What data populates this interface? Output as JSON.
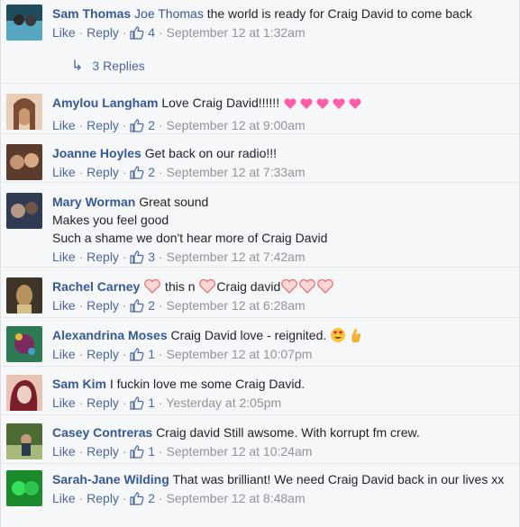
{
  "comments": [
    {
      "name": "Sam Thomas",
      "mention": "Joe Thomas",
      "text": " the world is ready for Craig David to come back",
      "like": "Like",
      "reply": "Reply",
      "likes": "4",
      "time": "September 12 at 1:32am",
      "replies_label": "3 Replies",
      "avatar_colors": [
        "#1f4d5e",
        "#58a7c2"
      ]
    },
    {
      "name": "Amylou Langham",
      "text": "Love Craig David!!!!!! ",
      "like": "Like",
      "reply": "Reply",
      "likes": "2",
      "time": "September 12 at 9:00am",
      "avatar_colors": [
        "#c99770",
        "#7a4d33"
      ]
    },
    {
      "name": "Joanne Hoyles",
      "text": "Get back on our radio!!!",
      "like": "Like",
      "reply": "Reply",
      "likes": "2",
      "time": "September 12 at 7:33am",
      "avatar_colors": [
        "#5b3b2c",
        "#c59473"
      ]
    },
    {
      "name": "Mary Worman",
      "text_lines": [
        "Great sound",
        "Makes you feel good",
        "Such a shame we don't hear more of Craig David"
      ],
      "like": "Like",
      "reply": "Reply",
      "likes": "3",
      "time": "September 12 at 7:42am",
      "avatar_colors": [
        "#303a52",
        "#b49889"
      ]
    },
    {
      "name": "Rachel Carney",
      "text_parts": [
        " this n ",
        "Craig david"
      ],
      "like": "Like",
      "reply": "Reply",
      "likes": "2",
      "time": "September 12 at 6:28am",
      "avatar_colors": [
        "#b89360",
        "#3e3528"
      ]
    },
    {
      "name": "Alexandrina Moses",
      "text": "Craig David love - reignited. ",
      "like": "Like",
      "reply": "Reply",
      "likes": "1",
      "time": "September 12 at 10:07pm",
      "avatar_colors": [
        "#2d7a55",
        "#7a2b5e"
      ]
    },
    {
      "name": "Sam Kim",
      "text": "I fuckin love me some Craig David.",
      "like": "Like",
      "reply": "Reply",
      "likes": "1",
      "time": "Yesterday at 2:05pm",
      "avatar_colors": [
        "#7a1f2a",
        "#e8c4b5"
      ]
    },
    {
      "name": "Casey Contreras",
      "text": "Craig david Still awsome. With korrupt fm crew.",
      "like": "Like",
      "reply": "Reply",
      "likes": "1",
      "time": "September 12 at 10:24am",
      "avatar_colors": [
        "#4d6b34",
        "#a7b87c"
      ]
    },
    {
      "name": "Sarah-Jane Wilding",
      "text": "That was brilliant! We need Craig David back in our lives xx",
      "like": "Like",
      "reply": "Reply",
      "likes": "2",
      "time": "September 12 at 8:48am",
      "avatar_colors": [
        "#1a8a2a",
        "#35e05a"
      ]
    }
  ],
  "colors": {
    "link": "#365899",
    "meta": "#90949c",
    "background": "#f6f7f9"
  }
}
